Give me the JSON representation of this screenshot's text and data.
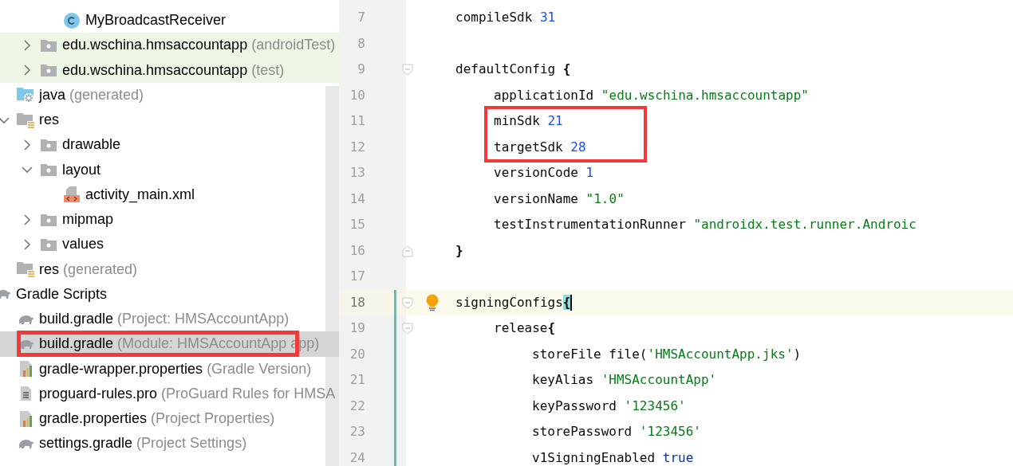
{
  "project_tree": {
    "items": [
      {
        "children": [
          {
            "children": [
              {
                "children": [
                  {
                    "label": "MyBroadcastReceiver",
                    "kind": "class",
                    "selected": false
                  }
                ]
              },
              {
                "label": "edu.wschina.hmsaccountapp",
                "note": "(androidTest)",
                "kind": "folder",
                "expanded": false,
                "selected": false,
                "tinted": true
              },
              {
                "label": "edu.wschina.hmsaccountapp",
                "note": "(test)",
                "kind": "folder",
                "expanded": false,
                "selected": false,
                "tinted": true
              }
            ]
          },
          {
            "label": "java",
            "note": "(generated)",
            "kind": "generated_folder",
            "selected": false
          },
          {
            "label": "res",
            "kind": "res_folder",
            "expanded": true,
            "selected": false,
            "children": [
              {
                "label": "drawable",
                "kind": "folder",
                "expanded": false,
                "selected": false
              },
              {
                "label": "layout",
                "kind": "folder",
                "expanded": true,
                "selected": false,
                "children": [
                  {
                    "label": "activity_main.xml",
                    "kind": "xml",
                    "selected": false
                  }
                ]
              },
              {
                "label": "mipmap",
                "kind": "folder",
                "expanded": false,
                "selected": false
              },
              {
                "label": "values",
                "kind": "folder",
                "expanded": false,
                "selected": false
              }
            ]
          },
          {
            "label": "res",
            "note": "(generated)",
            "kind": "res_folder",
            "selected": false
          }
        ]
      },
      {
        "label": "Gradle Scripts",
        "kind": "gradle",
        "selected": false,
        "children": [
          {
            "label": "build.gradle",
            "note": "(Project: HMSAccountApp)",
            "kind": "gradle",
            "selected": false
          },
          {
            "label": "build.gradle",
            "note": "(Module: HMSAccountApp app)",
            "kind": "gradle",
            "selected": true,
            "boxed": true
          },
          {
            "label": "gradle-wrapper.properties",
            "note": "(Gradle Version)",
            "kind": "properties",
            "selected": false
          },
          {
            "label": "proguard-rules.pro",
            "note": "(ProGuard Rules for HMSA",
            "kind": "text_file",
            "selected": false
          },
          {
            "label": "gradle.properties",
            "note": "(Project Properties)",
            "kind": "properties",
            "selected": false
          },
          {
            "label": "settings.gradle",
            "note": "(Project Settings)",
            "kind": "gradle",
            "selected": false
          }
        ]
      }
    ]
  },
  "editor": {
    "lines": [
      {
        "number": "7",
        "tokens": [
          {
            "text": "    compileSdk ",
            "kind": "plain"
          },
          {
            "text": "31",
            "kind": "number"
          }
        ]
      },
      {
        "number": "8"
      },
      {
        "number": "9",
        "fold_start": true,
        "tokens": [
          {
            "text": "    defaultConfig ",
            "kind": "plain"
          },
          {
            "text": "{",
            "kind": "bold"
          }
        ]
      },
      {
        "number": "10",
        "tokens": [
          {
            "text": "        applicationId ",
            "kind": "plain"
          },
          {
            "text": "\"edu.wschina.hmsaccountapp\"",
            "kind": "string"
          }
        ]
      },
      {
        "number": "11",
        "boxed": true,
        "tokens": [
          {
            "text": "        minSdk ",
            "kind": "plain"
          },
          {
            "text": "21",
            "kind": "number"
          }
        ]
      },
      {
        "number": "12",
        "boxed": true,
        "tokens": [
          {
            "text": "        targetSdk ",
            "kind": "plain"
          },
          {
            "text": "28",
            "kind": "number"
          }
        ]
      },
      {
        "number": "13",
        "tokens": [
          {
            "text": "        versionCode ",
            "kind": "plain"
          },
          {
            "text": "1",
            "kind": "number"
          }
        ]
      },
      {
        "number": "14",
        "tokens": [
          {
            "text": "        versionName ",
            "kind": "plain"
          },
          {
            "text": "\"1.0\"",
            "kind": "string"
          }
        ]
      },
      {
        "number": "15",
        "tokens": [
          {
            "text": "        testInstrumentationRunner ",
            "kind": "plain"
          },
          {
            "text": "\"androidx.test.runner.Androic",
            "kind": "string"
          }
        ]
      },
      {
        "number": "16",
        "fold_end": true,
        "tokens": [
          {
            "text": "    }",
            "kind": "bold"
          }
        ]
      },
      {
        "number": "17"
      },
      {
        "number": "18",
        "current": true,
        "changed": true,
        "bulb": true,
        "fold_start": true,
        "tokens": [
          {
            "text": "    signingConfigs",
            "kind": "plain"
          },
          {
            "text": "{",
            "kind": "brace_match",
            "caret": true
          }
        ]
      },
      {
        "number": "19",
        "changed": true,
        "fold_start": true,
        "tokens": [
          {
            "text": "        release",
            "kind": "plain"
          },
          {
            "text": "{",
            "kind": "bold"
          }
        ]
      },
      {
        "number": "20",
        "changed": true,
        "tokens": [
          {
            "text": "            storeFile file(",
            "kind": "plain"
          },
          {
            "text": "'HMSAccountApp.jks'",
            "kind": "string"
          },
          {
            "text": ")",
            "kind": "plain"
          }
        ]
      },
      {
        "number": "21",
        "changed": true,
        "tokens": [
          {
            "text": "            keyAlias ",
            "kind": "plain"
          },
          {
            "text": "'HMSAccountApp'",
            "kind": "string"
          }
        ]
      },
      {
        "number": "22",
        "changed": true,
        "tokens": [
          {
            "text": "            keyPassword ",
            "kind": "plain"
          },
          {
            "text": "'123456'",
            "kind": "string"
          }
        ]
      },
      {
        "number": "23",
        "changed": true,
        "tokens": [
          {
            "text": "            storePassword ",
            "kind": "plain"
          },
          {
            "text": "'123456'",
            "kind": "string"
          }
        ]
      },
      {
        "number": "24",
        "changed": true,
        "tokens": [
          {
            "text": "            v1SigningEnabled ",
            "kind": "plain"
          },
          {
            "text": "true",
            "kind": "keyword"
          }
        ]
      }
    ]
  }
}
